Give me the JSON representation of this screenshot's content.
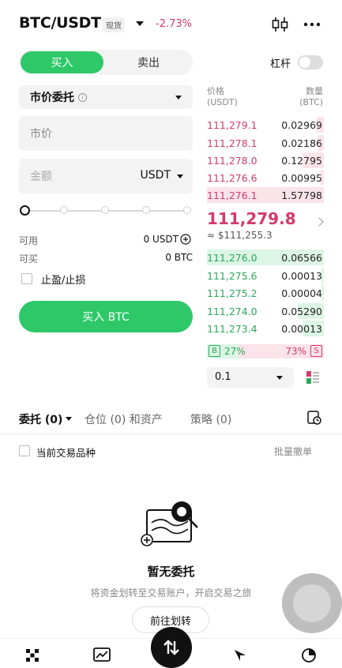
{
  "header": {
    "pair": "BTC/USDT",
    "market_tag": "现货",
    "change": "-2.73%"
  },
  "trade": {
    "buy_tab": "买入",
    "sell_tab": "卖出",
    "leverage_label": "杠杆",
    "order_type": "市价委托",
    "order_type_info": "i",
    "price_field": "市价",
    "amount_placeholder": "金额",
    "amount_unit": "USDT",
    "available_label": "可用",
    "available_value": "0 USDT",
    "buyable_label": "可买",
    "buyable_value": "0 BTC",
    "tpsl_label": "止盈/止损",
    "buy_button": "买入 BTC"
  },
  "orderbook": {
    "price_header": "价格",
    "price_unit": "(USDT)",
    "qty_header": "数量",
    "qty_unit": "(BTC)",
    "asks": [
      {
        "price": "111,279.1",
        "qty": "0.02969",
        "depth": 0.06
      },
      {
        "price": "111,278.1",
        "qty": "0.02186",
        "depth": 0.05
      },
      {
        "price": "111,278.0",
        "qty": "0.12795",
        "depth": 0.18
      },
      {
        "price": "111,276.6",
        "qty": "0.00995",
        "depth": 0.03
      },
      {
        "price": "111,276.1",
        "qty": "1.57798",
        "depth": 1.0
      }
    ],
    "last_price": "111,279.8",
    "last_price_fiat": "≈ $111,255.3",
    "bids": [
      {
        "price": "111,276.0",
        "qty": "0.06566",
        "depth": 1.0
      },
      {
        "price": "111,275.6",
        "qty": "0.00013",
        "depth": 0.02
      },
      {
        "price": "111,275.2",
        "qty": "0.00004",
        "depth": 0.02
      },
      {
        "price": "111,274.0",
        "qty": "0.05290",
        "depth": 0.22
      },
      {
        "price": "111,273.4",
        "qty": "0.00013",
        "depth": 0.18
      }
    ],
    "buy_label": "B",
    "buy_pct": "27%",
    "sell_pct": "73%",
    "sell_label": "S",
    "buy_ratio": 0.27,
    "depth_step": "0.1"
  },
  "tabs": {
    "orders": "委托 (0)",
    "positions": "仓位 (0) 和资产",
    "strategy": "策略 (0)"
  },
  "filter": {
    "current_symbol": "当前交易品种",
    "batch_cancel": "批量撤单"
  },
  "empty": {
    "title": "暂无委托",
    "subtitle": "将资金划转至交易账户，开启交易之旅",
    "button": "前往划转"
  },
  "colors": {
    "green": "#2ec869",
    "red": "#d43a6a"
  }
}
